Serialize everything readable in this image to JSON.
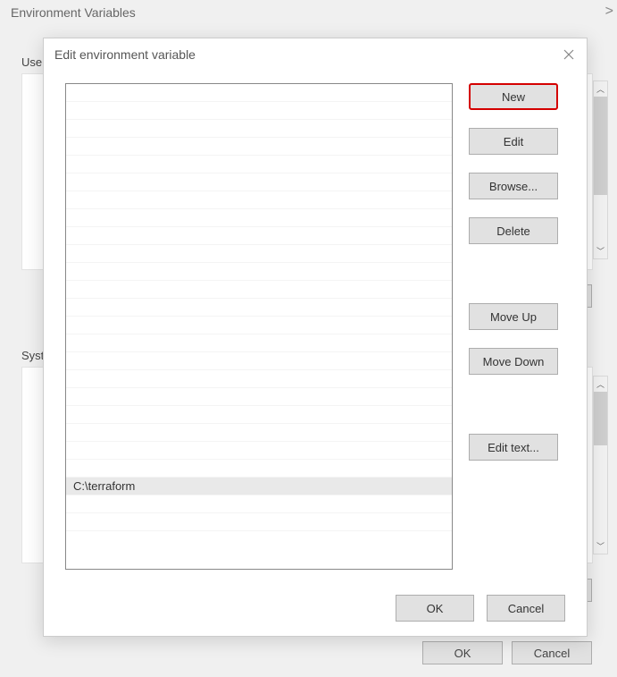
{
  "bg": {
    "title": "Environment Variables",
    "userLabel": "User",
    "systemLabel": "Syste",
    "buttons": {
      "ok": "OK",
      "cancel": "Cancel"
    }
  },
  "fg": {
    "title": "Edit environment variable",
    "selectedValue": "C:\\terraform",
    "buttons": {
      "new": "New",
      "edit": "Edit",
      "browse": "Browse...",
      "delete": "Delete",
      "moveUp": "Move Up",
      "moveDown": "Move Down",
      "editText": "Edit text...",
      "ok": "OK",
      "cancel": "Cancel"
    }
  }
}
